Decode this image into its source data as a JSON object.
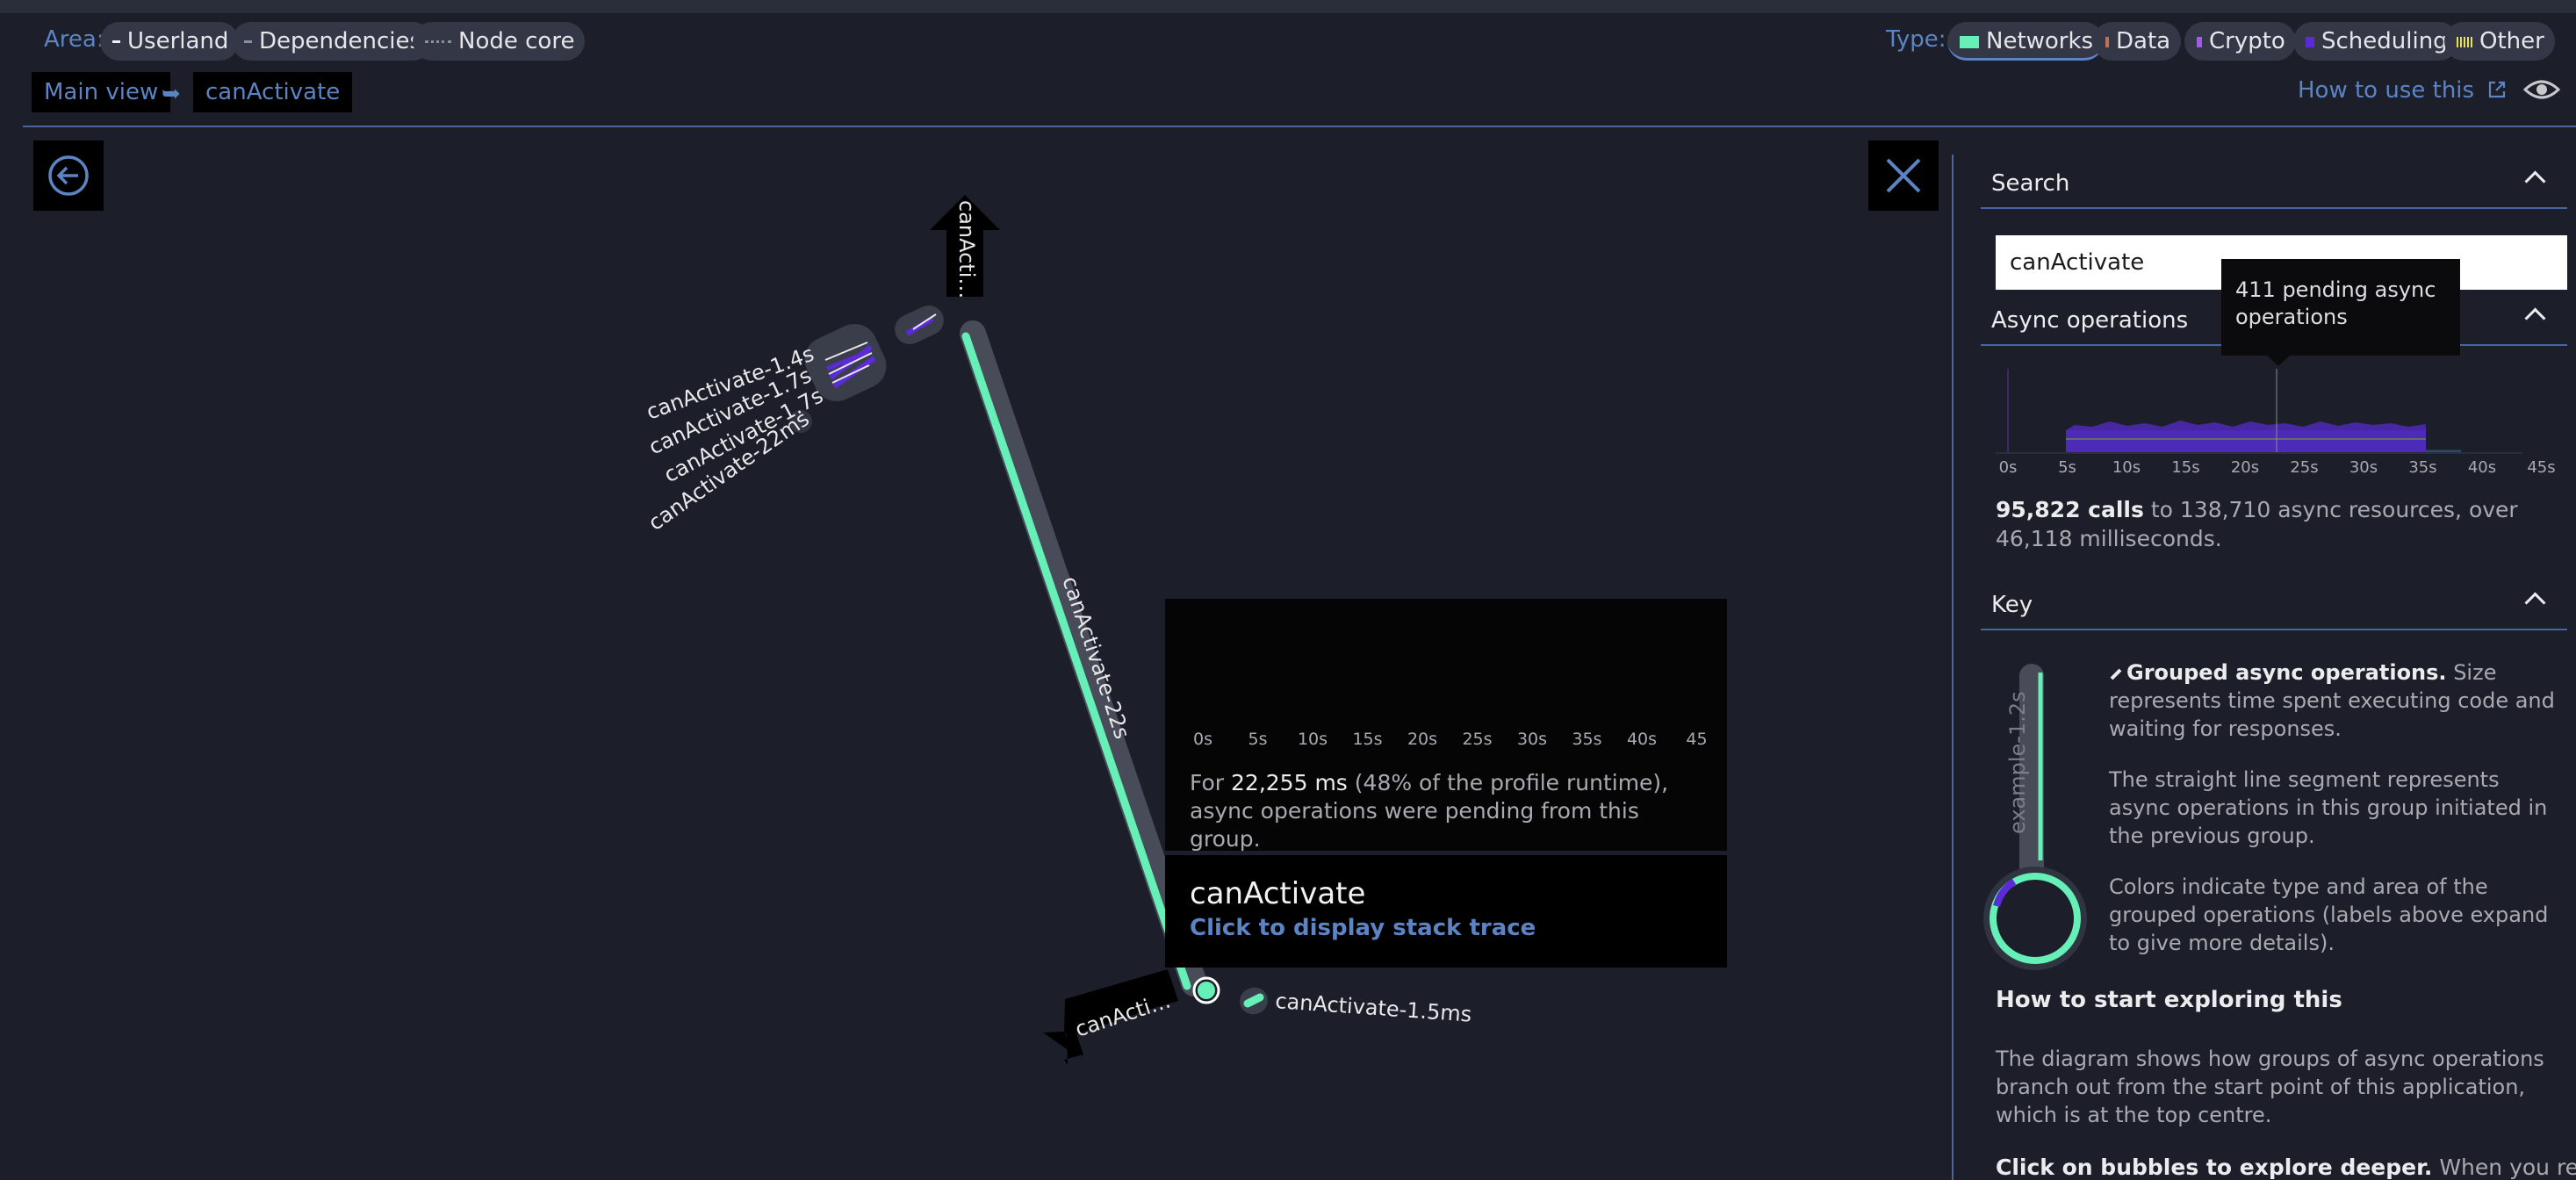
{
  "filters": {
    "area_label": "Area:",
    "area_chips": [
      "Userland",
      "Dependencies",
      "Node core"
    ],
    "type_label": "Type:",
    "type_chips": [
      "Networks",
      "Data",
      "Crypto",
      "Scheduling",
      "Other"
    ]
  },
  "breadcrumb": {
    "items": [
      "Main view",
      "canActivate"
    ],
    "separator": "➥"
  },
  "help": {
    "label": "How to use this"
  },
  "diagram": {
    "labels": {
      "top_arrow": "canActi…",
      "main_branch": "canActivate-22s",
      "cluster": [
        "canActivate-1.4s",
        "canActivate-1.7s",
        "canActivate-1.7s",
        "canActivate-22ms"
      ],
      "bottom_arrow": "canActi…",
      "small_node": "canActivate-1.5ms"
    }
  },
  "tooltip": {
    "axis_ticks": [
      "0s",
      "5s",
      "10s",
      "15s",
      "20s",
      "25s",
      "30s",
      "35s",
      "40s",
      "45"
    ],
    "pending_value": "22,255 ms",
    "pending_prefix": "For",
    "pending_suffix": "(48% of the profile runtime), async operations were pending from this group.",
    "title": "canActivate",
    "link": "Click to display stack trace"
  },
  "panel": {
    "search": {
      "title": "Search",
      "value": "canActivate"
    },
    "async": {
      "title": "Async operations",
      "popup": "411 pending async operations",
      "axis_ticks": [
        "0s",
        "5s",
        "10s",
        "15s",
        "20s",
        "25s",
        "30s",
        "35s",
        "40s",
        "45s"
      ],
      "calls": "95,822 calls",
      "calls_rest": "to 138,710 async resources, over 46,118 milliseconds."
    },
    "key": {
      "title": "Key",
      "example_label": "example-1.2s",
      "grouped_title": "Grouped async operations.",
      "grouped_text": "Size represents time spent executing code and waiting for responses.",
      "line_text": "The straight line segment represents async operations in this group initiated in the previous group.",
      "colors_text": "Colors indicate type and area of the grouped operations (labels above expand to give more details)."
    },
    "explore": {
      "title": "How to start exploring this",
      "text": "The diagram shows how groups of async operations branch out from the start point of this application, which is at the top centre.",
      "bubbles_title": "Click on bubbles to explore deeper.",
      "bubbles_text": "When you reach"
    }
  },
  "colors": {
    "background": "#1c1f2a",
    "accent": "#5b84c4",
    "networks": "#66f0b8",
    "scheduling": "#5a2bd6",
    "crypto": "#9b5fe0",
    "data": "#c0705a",
    "other": "#e8e05a"
  }
}
